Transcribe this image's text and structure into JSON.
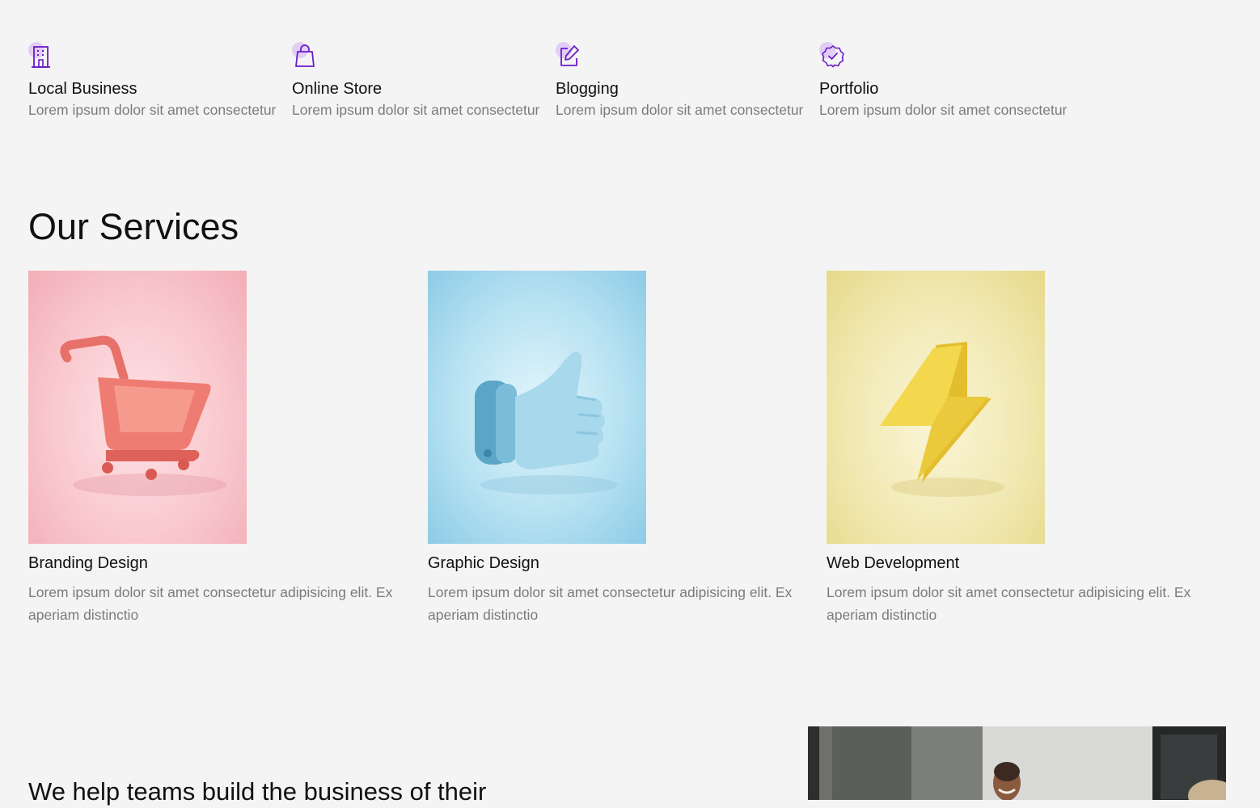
{
  "colors": {
    "background": "#f4f4f4",
    "accent": "#6a1cc8",
    "accent_soft": "#e2cdf4",
    "muted_text": "#7b7b7b"
  },
  "features": [
    {
      "icon": "building-icon",
      "title": "Local Business",
      "desc": "Lorem ipsum dolor sit amet consectetur"
    },
    {
      "icon": "shopping-bag-icon",
      "title": "Online Store",
      "desc": "Lorem ipsum dolor sit amet consectetur"
    },
    {
      "icon": "edit-icon",
      "title": "Blogging",
      "desc": "Lorem ipsum dolor sit amet consectetur"
    },
    {
      "icon": "verified-badge-icon",
      "title": "Portfolio",
      "desc": "Lorem ipsum dolor sit amet consectetur"
    }
  ],
  "services": {
    "heading": "Our Services",
    "items": [
      {
        "image": "shopping-cart-3d-image",
        "title": "Branding Design",
        "desc": "Lorem ipsum dolor sit amet consectetur adipisicing elit. Ex aperiam distinctio"
      },
      {
        "image": "thumbs-up-3d-image",
        "title": "Graphic Design",
        "desc": "Lorem ipsum dolor sit amet consectetur adipisicing elit. Ex aperiam distinctio"
      },
      {
        "image": "lightning-bolt-3d-image",
        "title": "Web Development",
        "desc": "Lorem ipsum dolor sit amet consectetur adipisicing elit. Ex aperiam distinctio"
      }
    ]
  },
  "about": {
    "heading": "We help teams build the business of their",
    "image": "team-office-photo"
  }
}
